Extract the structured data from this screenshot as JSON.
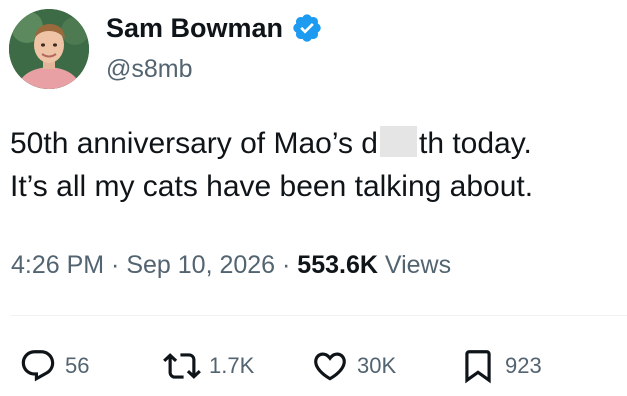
{
  "author": {
    "display_name": "Sam Bowman",
    "handle": "@s8mb",
    "verified_icon": "verified-badge-icon",
    "verified_color": "#1d9bf0"
  },
  "tweet": {
    "line1_start": "50th anniversary of Mao’s d",
    "line1_end": "th today.",
    "line2": "It’s all my cats have been talking about."
  },
  "meta": {
    "time": "4:26 PM",
    "sep1": " · ",
    "date": "Sep 10, 2026",
    "sep2": " · ",
    "views_count": "553.6K",
    "views_label": " Views"
  },
  "actions": {
    "reply_count": "56",
    "retweet_count": "1.7K",
    "like_count": "30K",
    "bookmark_count": "923"
  },
  "colors": {
    "text_primary": "#0f1419",
    "text_secondary": "#536471",
    "accent": "#1d9bf0"
  }
}
